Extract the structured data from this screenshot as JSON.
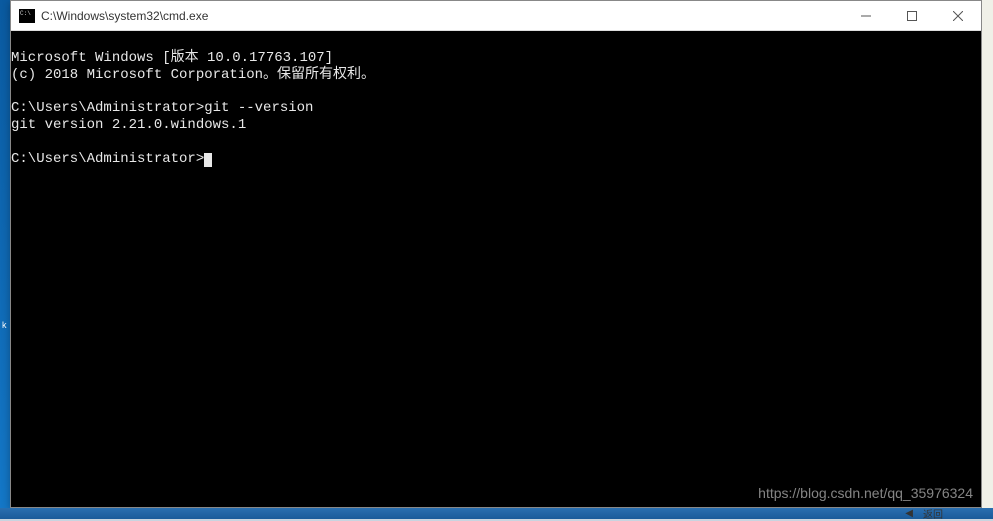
{
  "window": {
    "title": "C:\\Windows\\system32\\cmd.exe"
  },
  "terminal": {
    "line1": "Microsoft Windows [版本 10.0.17763.107]",
    "line2": "(c) 2018 Microsoft Corporation。保留所有权利。",
    "line3": "",
    "line4": "C:\\Users\\Administrator>git --version",
    "line5": "git version 2.21.0.windows.1",
    "line6": "",
    "line7": "C:\\Users\\Administrator>"
  },
  "desktop": {
    "icon_label_k": "k"
  },
  "watermark": "https://blog.csdn.net/qq_35976324",
  "taskbar": {
    "back_label": "返回"
  }
}
